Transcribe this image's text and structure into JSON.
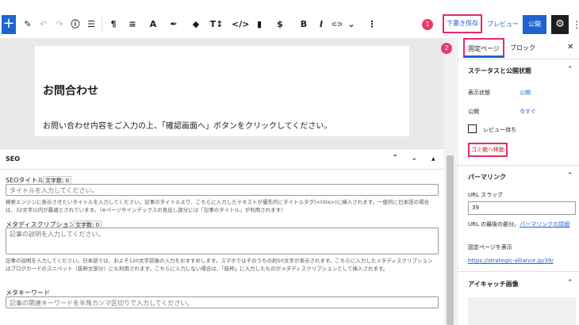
{
  "toolbar": {
    "add": "+",
    "icons": [
      "✎",
      "↶",
      "↷",
      "ⓘ",
      "☰",
      "¶",
      "≡",
      "A",
      "✒",
      "◆",
      "T↕",
      "</>",
      "▮",
      "$",
      "B",
      "I",
      "⊂⊃",
      "⌄",
      "⋮"
    ],
    "badge1": "1",
    "save_draft": "下書き保存",
    "preview": "プレビュー",
    "publish": "公開",
    "gear": "⚙",
    "more": "⋮"
  },
  "page": {
    "title": "お問合わせ",
    "text": "お問い合わせ内容をご入力の上、「確認画面へ」ボタンをクリックしてください。"
  },
  "seo": {
    "heading": "SEO",
    "ctrl_up": "⌃",
    "ctrl_down": "⌄",
    "ctrl_drag": "▲",
    "title_label": "SEOタイトル",
    "title_count": "文字数: 0",
    "title_placeholder": "タイトルを入力してください。",
    "title_help": "検索エンジンに表示させたいタイトルを入力してください。記事のタイトルより、こちらに入力したテキストが優先的にタイトルタグ(<title>)に挿入されます。一般的に日本語の場合は、32文字以内が最適とされています。（※ページやインデックスの見出し部分には「記事のタイトル」が利用されます）",
    "desc_label": "メタディスクリプション",
    "desc_count": "文字数: 0",
    "desc_placeholder": "記事の説明を入力してください。",
    "desc_help": "記事の説明を入力してください。日本語では、およそ120文字前後の入力をおすすめします。スマホではそのうちの約50文字が表示されます。こちらに入力したメタディスクリプションはブログカードのスニペット（抜粋文部分）にも利用されます。こちらに入力しない場合は、「抜粋」に入力したものがメタディスクリプションとして挿入されます。",
    "kw_label": "メタキーワード",
    "kw_placeholder": "記事の関連キーワードを半角カンマ区切りで入力してください。"
  },
  "sidebar": {
    "badge2": "2",
    "tab_doc": "固定ページ",
    "tab_block": "ブロック",
    "close": "✕",
    "status_section": "ステータスと公開状態",
    "visibility_label": "表示状態",
    "visibility_value": "公開",
    "publish_label": "公開",
    "publish_value": "今すぐ",
    "pending_label": "レビュー待ち",
    "trash": "ゴミ箱へ移動",
    "permalink_section": "パーマリンク",
    "slug_label": "URL スラッグ",
    "slug_value": "39",
    "slug_help_prefix": "URL の最後の部分。",
    "slug_help_link": "パーマリンクの詳細",
    "view_page": "固定ページを表示",
    "url": "https://strategic-alliance.jp/39/",
    "featured_section": "アイキャッチ画像",
    "chevron_up": "⌃"
  }
}
